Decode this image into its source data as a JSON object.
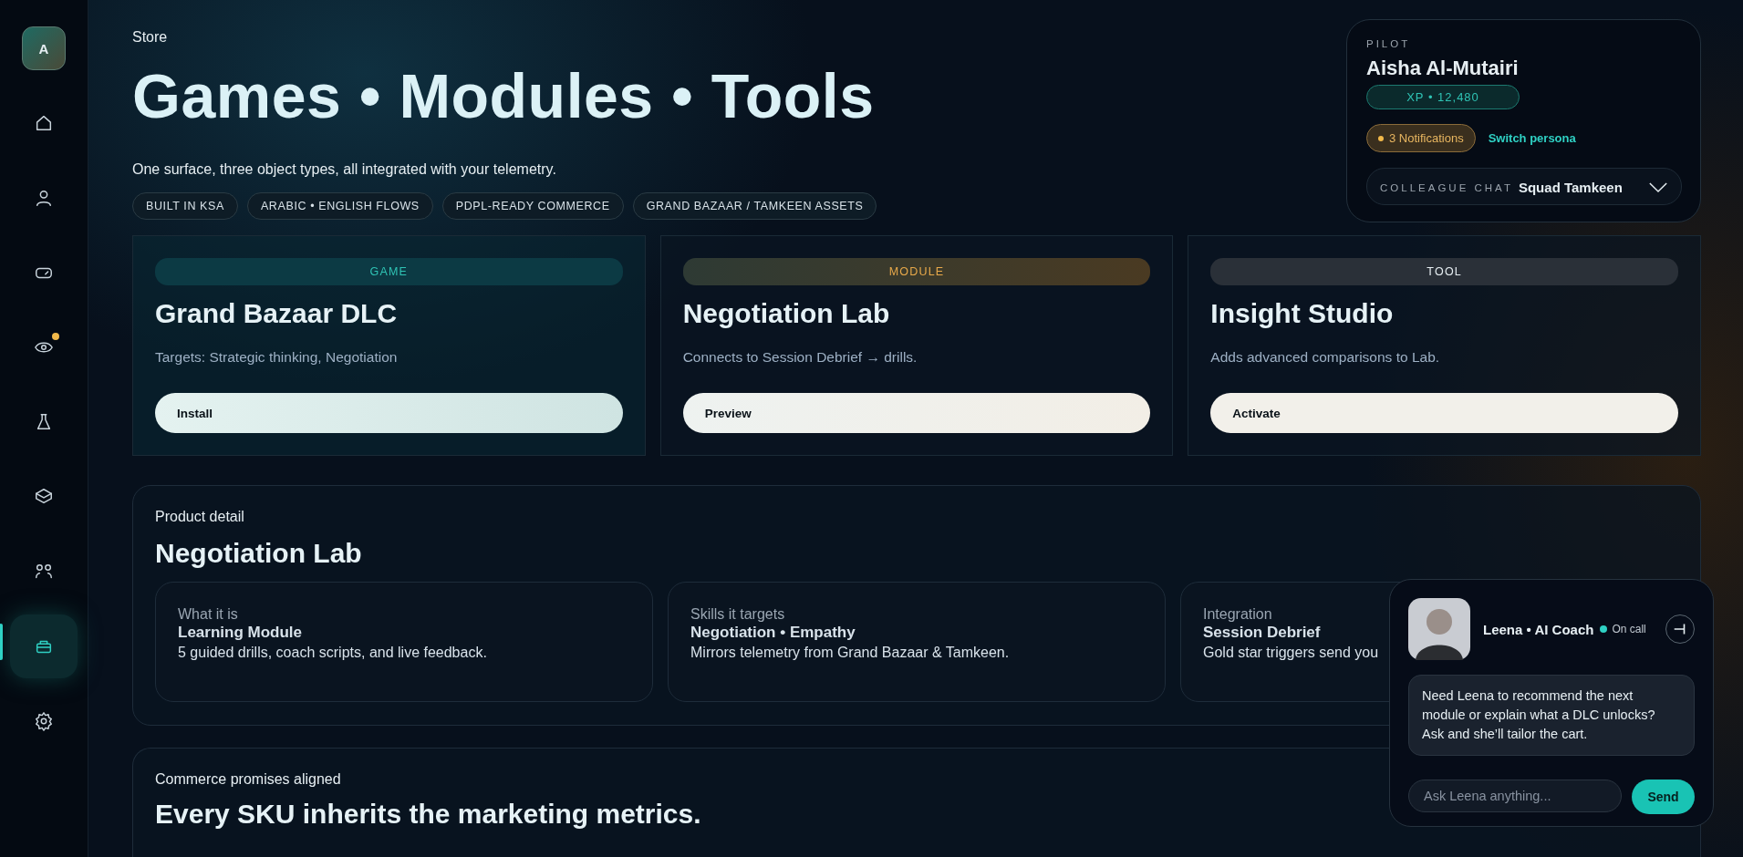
{
  "sidebar": {
    "avatar": "A",
    "items": [
      {
        "kind": "home",
        "selected": false,
        "badge": false
      },
      {
        "kind": "person",
        "selected": false,
        "badge": false
      },
      {
        "kind": "gamepad",
        "selected": false,
        "badge": false
      },
      {
        "kind": "eye",
        "selected": false,
        "badge": true
      },
      {
        "kind": "flask",
        "selected": false,
        "badge": false
      },
      {
        "kind": "layers",
        "selected": false,
        "badge": false
      },
      {
        "kind": "people",
        "selected": false,
        "badge": false
      },
      {
        "kind": "bag",
        "selected": true,
        "badge": false
      },
      {
        "kind": "gear",
        "selected": false,
        "badge": false
      }
    ]
  },
  "breadcrumb": "Store",
  "title": "Games • Modules • Tools",
  "subtitle": "One surface, three object types, all integrated with your telemetry.",
  "tags": [
    "BUILT IN KSA",
    "ARABIC • ENGLISH FLOWS",
    "PDPL-READY COMMERCE",
    "GRAND BAZAAR / TAMKEEN ASSETS"
  ],
  "pilot": {
    "label": "PILOT",
    "name": "Aisha Al-Mutairi",
    "xp": "XP • 12,480",
    "notifications": "3 Notifications",
    "switch": "Switch persona",
    "chat_label": "COLLEAGUE CHAT",
    "chat_value": "Squad Tamkeen"
  },
  "products": [
    {
      "kind": "game",
      "tag": "GAME",
      "name": "Grand Bazaar DLC",
      "description": "Targets: Strategic thinking, Negotiation",
      "action": "Install"
    },
    {
      "kind": "module",
      "tag": "MODULE",
      "name": "Negotiation Lab",
      "description": "Connects to Session Debrief → drills.",
      "action": "Preview"
    },
    {
      "kind": "tool",
      "tag": "TOOL",
      "name": "Insight Studio",
      "description": "Adds advanced comparisons to Lab.",
      "action": "Activate"
    }
  ],
  "detail": {
    "eyebrow": "Product detail",
    "title": "Negotiation Lab",
    "facts": [
      {
        "label": "What it is",
        "value": "Learning Module",
        "text": "5 guided drills, coach scripts, and live feedback."
      },
      {
        "label": "Skills it targets",
        "value": "Negotiation • Empathy",
        "text": "Mirrors telemetry from Grand Bazaar & Tamkeen."
      },
      {
        "label": "Integration",
        "value": "Session Debrief",
        "text": "Gold star triggers send you"
      }
    ]
  },
  "commerce": {
    "eyebrow": "Commerce promises aligned",
    "title": "Every SKU inherits the marketing metrics."
  },
  "coach": {
    "name": "Leena • AI Coach",
    "status": "On call",
    "message": "Need Leena to recommend the next module or explain what a DLC unlocks? Ask and she’ll tailor the cart.",
    "placeholder": "Ask Leena anything...",
    "send": "Send"
  }
}
